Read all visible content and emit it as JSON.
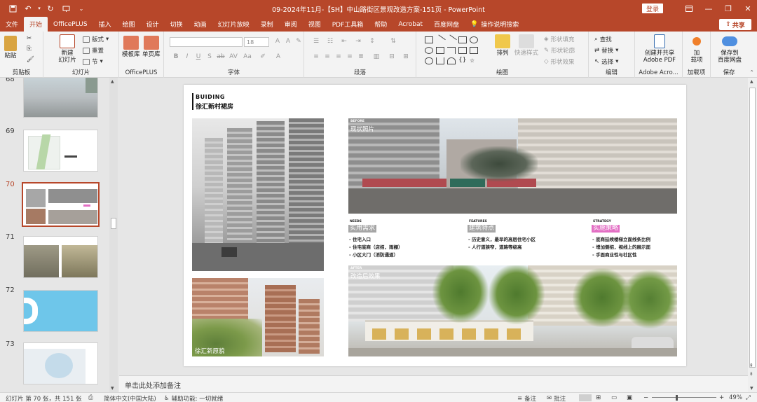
{
  "window": {
    "title": "09-2024年11月-【SH】中山路街区景观改造方案-151页  -  PowerPoint",
    "login_label": "登录"
  },
  "ribbon_tabs": [
    "文件",
    "开始",
    "OfficePLUS",
    "插入",
    "绘图",
    "设计",
    "切换",
    "动画",
    "幻灯片放映",
    "录制",
    "审阅",
    "视图",
    "PDF工具箱",
    "帮助",
    "Acrobat",
    "百度网盘"
  ],
  "ribbon_active_tab": "开始",
  "tell_me": "操作说明搜索",
  "share_label": "共享",
  "ribbon": {
    "clipboard": {
      "paste": "粘贴",
      "label": "剪贴板"
    },
    "slides": {
      "new_slide": "新建\n幻灯片",
      "layout": "版式",
      "reset": "重置",
      "section": "节",
      "label": "幻灯片"
    },
    "officeplus": {
      "template": "模板库",
      "single_page": "单页库",
      "label": "OfficePLUS"
    },
    "font": {
      "font_size": "18",
      "label": "字体"
    },
    "paragraph": {
      "label": "段落"
    },
    "drawing": {
      "arrange": "排列",
      "quick_styles": "快速样式",
      "shape_fill": "形状填充",
      "shape_outline": "形状轮廓",
      "shape_effects": "形状效果",
      "label": "绘图"
    },
    "editing": {
      "find": "查找",
      "replace": "替换",
      "select": "选择",
      "label": "编辑"
    },
    "adobe": {
      "create": "创建并共享\nAdobe PDF",
      "label": "Adobe Acro..."
    },
    "addins": {
      "add": "加\n载项",
      "label": "加载项"
    },
    "save": {
      "save_to": "保存到\n百度网盘",
      "label": "保存"
    }
  },
  "thumbnails": [
    {
      "number": "68"
    },
    {
      "number": "69"
    },
    {
      "number": "70",
      "active": true
    },
    {
      "number": "71"
    },
    {
      "number": "72"
    },
    {
      "number": "73"
    }
  ],
  "slide": {
    "heading_en": "BUIDING",
    "heading_cn": "徐汇新村裙房",
    "before_tag": "BEFORE",
    "before_label": "现状照片",
    "after_tag": "AFTER",
    "after_label": "改造后效果",
    "xinyuan_label": "徐汇新原貌",
    "columns": [
      {
        "tag": "NEEDS",
        "title": "实用需求",
        "title_bg": "#a6a6a6",
        "items": [
          "- 住宅入口",
          "- 住宅底商（店招，雨棚）",
          "- 小区大门（消防通道）"
        ]
      },
      {
        "tag": "FEATURES",
        "title": "建筑特点",
        "title_bg": "#a6a6a6",
        "items": [
          "- 历史意义，最早的高层住宅小区",
          "- 人行道狭窄，道路等级高"
        ]
      },
      {
        "tag": "STRATEGY",
        "title": "实施策略",
        "title_bg": "#e36fc4",
        "items": [
          "- 底商延续楼梯立面线条比例",
          "- 增加侧招，视线上的展示面",
          "- 手面商业性与社区性"
        ]
      }
    ]
  },
  "notes_placeholder": "单击此处添加备注",
  "status": {
    "slide_info": "幻灯片 第 70 张，共 151 张",
    "language": "简体中文(中国大陆)",
    "accessibility": "辅助功能: 一切就绪",
    "notes": "备注",
    "comments": "批注",
    "zoom": "49%"
  },
  "colors": {
    "accent": "#b7472a",
    "ribbon_bg": "#f3f3f3",
    "workspace_bg": "#e6e6e6",
    "strategy_pink": "#e36fc4"
  }
}
